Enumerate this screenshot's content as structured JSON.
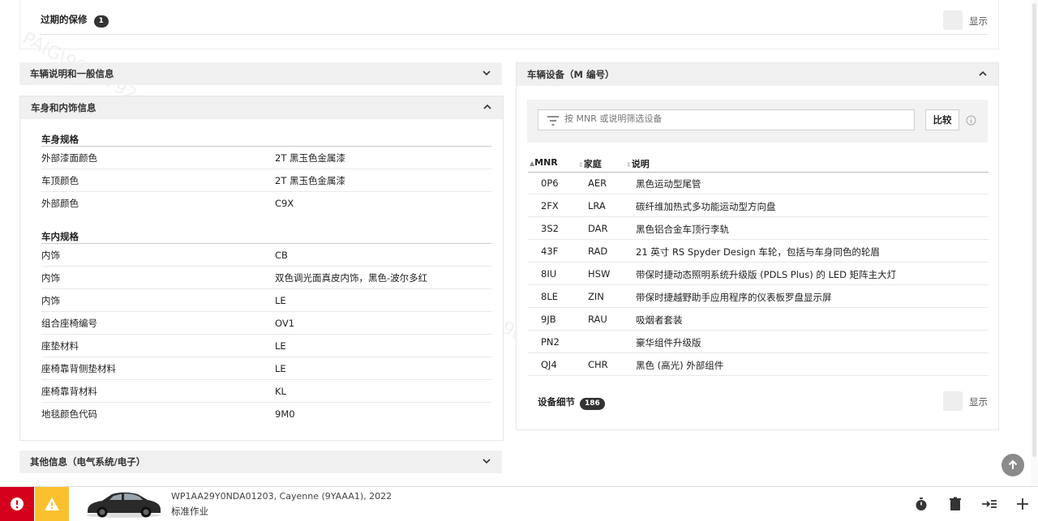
{
  "expired_warranty": {
    "label": "过期的保修",
    "count": "1",
    "show_label": "显示"
  },
  "sections": {
    "general": "车辆说明和一般信息",
    "body_interior": "车身和内饰信息",
    "other": "其他信息（电气系统/电子）",
    "equipment": "车辆设备（M 编号）"
  },
  "body_spec": {
    "title": "车身规格",
    "rows": [
      {
        "k": "外部漆面颜色",
        "v": "2T 黑玉色金属漆"
      },
      {
        "k": "车顶颜色",
        "v": "2T 黑玉色金属漆"
      },
      {
        "k": "外部颜色",
        "v": "C9X"
      }
    ]
  },
  "interior_spec": {
    "title": "车内规格",
    "rows": [
      {
        "k": "内饰",
        "v": "CB"
      },
      {
        "k": "内饰",
        "v": "双色调光面真皮内饰，黑色-波尔多红"
      },
      {
        "k": "内饰",
        "v": "LE"
      },
      {
        "k": "组合座椅编号",
        "v": "OV1"
      },
      {
        "k": "座垫材料",
        "v": "LE"
      },
      {
        "k": "座椅靠背侧垫材料",
        "v": "LE"
      },
      {
        "k": "座椅靠背材料",
        "v": "KL"
      },
      {
        "k": "地毯颜色代码",
        "v": "9M0"
      }
    ]
  },
  "equipment": {
    "filter_placeholder": "按 MNR 或说明筛选设备",
    "compare_label": "比较",
    "columns": [
      "MNR",
      "家庭",
      "说明"
    ],
    "rows": [
      {
        "mnr": "0P6",
        "fam": "AER",
        "desc": "黑色运动型尾管"
      },
      {
        "mnr": "2FX",
        "fam": "LRA",
        "desc": "碳纤维加热式多功能运动型方向盘"
      },
      {
        "mnr": "3S2",
        "fam": "DAR",
        "desc": "黑色铝合金车顶行李轨"
      },
      {
        "mnr": "43F",
        "fam": "RAD",
        "desc": "21 英寸 RS Spyder Design 车轮，包括与车身同色的轮眉"
      },
      {
        "mnr": "8IU",
        "fam": "HSW",
        "desc": "带保时捷动态照明系统升级版 (PDLS Plus) 的 LED 矩阵主大灯"
      },
      {
        "mnr": "8LE",
        "fam": "ZIN",
        "desc": "带保时捷越野助手应用程序的仪表板罗盘显示屏"
      },
      {
        "mnr": "9JB",
        "fam": "RAU",
        "desc": "吸烟者套装"
      },
      {
        "mnr": "PN2",
        "fam": "",
        "desc": "豪华组件升级版"
      },
      {
        "mnr": "QJ4",
        "fam": "CHR",
        "desc": "黑色 (高光) 外部组件"
      }
    ],
    "details_label": "设备细节",
    "details_count": "186",
    "show_label": "显示"
  },
  "footer": {
    "vehicle_line": "WP1AA29Y0NDA01203, Cayenne (9YAAA1), 2022",
    "work_type": "标准作业"
  },
  "watermarks": [
    "PAIG\\9006792",
    "172.20.1.35",
    "PAIG\\9006792"
  ]
}
